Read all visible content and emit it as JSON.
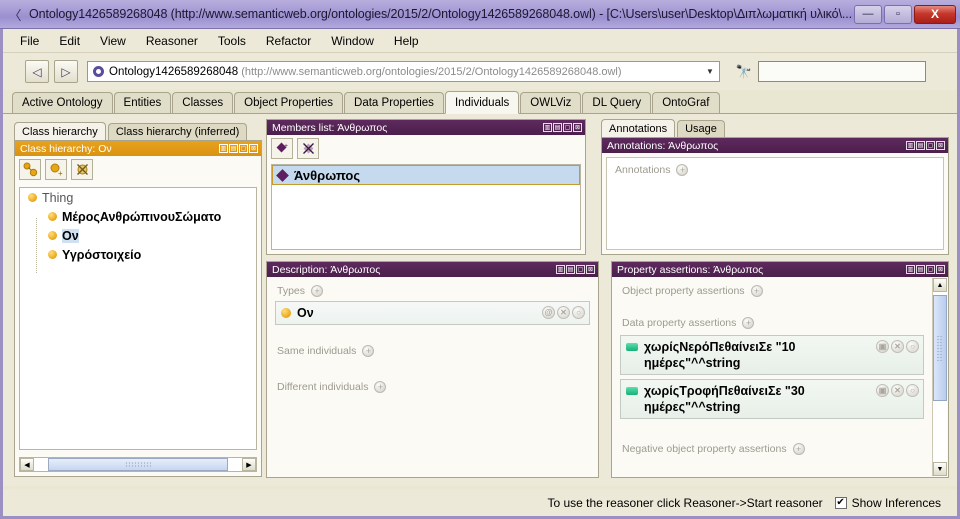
{
  "window": {
    "title": "Ontology1426589268048 (http://www.semanticweb.org/ontologies/2015/2/Ontology1426589268048.owl) - [C:\\Users\\user\\Desktop\\Διπλωματική υλικό\\...",
    "app_icon": "protege-icon",
    "minimize_label": "—",
    "maximize_label": "▫",
    "close_label": "X"
  },
  "menubar": {
    "items": [
      {
        "label": "File"
      },
      {
        "label": "Edit"
      },
      {
        "label": "View"
      },
      {
        "label": "Reasoner"
      },
      {
        "label": "Tools"
      },
      {
        "label": "Refactor"
      },
      {
        "label": "Window"
      },
      {
        "label": "Help"
      }
    ]
  },
  "toolbar": {
    "back_label": "◁",
    "forward_label": "▷",
    "ontology_name": "Ontology1426589268048",
    "ontology_iri": "(http://www.semanticweb.org/ontologies/2015/2/Ontology1426589268048.owl)",
    "dropdown_arrow": "▼",
    "search_icon": "binoculars-icon",
    "search_value": "",
    "search_placeholder": ""
  },
  "tabs": [
    {
      "label": "Active Ontology",
      "active": false
    },
    {
      "label": "Entities",
      "active": false
    },
    {
      "label": "Classes",
      "active": false
    },
    {
      "label": "Object Properties",
      "active": false
    },
    {
      "label": "Data Properties",
      "active": false
    },
    {
      "label": "Individuals",
      "active": true
    },
    {
      "label": "OWLViz",
      "active": false
    },
    {
      "label": "DL Query",
      "active": false
    },
    {
      "label": "OntoGraf",
      "active": false
    }
  ],
  "class_hierarchy": {
    "subtabs": [
      {
        "label": "Class hierarchy",
        "active": true
      },
      {
        "label": "Class hierarchy (inferred)",
        "active": false
      }
    ],
    "panel_title": "Class hierarchy: Ον",
    "tool_buttons": [
      {
        "name": "add-subclass-button"
      },
      {
        "name": "add-sibling-class-button"
      },
      {
        "name": "delete-class-button"
      }
    ],
    "tree": [
      {
        "label": "Thing",
        "level": 0,
        "selected": false
      },
      {
        "label": "ΜέροςΑνθρώπινουΣώματο",
        "level": 1,
        "selected": false
      },
      {
        "label": "Ον",
        "level": 1,
        "selected": true
      },
      {
        "label": "Υγρόστοιχείο",
        "level": 1,
        "selected": false
      }
    ]
  },
  "members_list": {
    "panel_title": "Members list: Άνθρωπος",
    "tool_buttons": [
      {
        "name": "add-individual-button"
      },
      {
        "name": "delete-individual-button"
      }
    ],
    "items": [
      {
        "label": "Άνθρωπος",
        "selected": true
      }
    ]
  },
  "description": {
    "panel_title": "Description: Άνθρωπος",
    "sections": [
      {
        "label": "Types",
        "name": "types-section"
      },
      {
        "label": "Same individuals",
        "name": "same-individuals-section"
      },
      {
        "label": "Different individuals",
        "name": "different-individuals-section"
      }
    ],
    "types_value": "Ον",
    "row_buttons": [
      "@",
      "✕",
      "○"
    ]
  },
  "annotations": {
    "subtabs": [
      {
        "label": "Annotations",
        "active": true
      },
      {
        "label": "Usage",
        "active": false
      }
    ],
    "panel_title": "Annotations: Άνθρωπος",
    "section_label": "Annotations"
  },
  "property_assertions": {
    "panel_title": "Property assertions: Άνθρωπος",
    "sections": [
      {
        "label": "Object property assertions",
        "name": "object-property-assertions-section"
      },
      {
        "label": "Data property assertions",
        "name": "data-property-assertions-section"
      },
      {
        "label": "Negative object property assertions",
        "name": "negative-object-property-assertions-section"
      }
    ],
    "data_assertions": [
      {
        "text": "χωρίςΝερόΠεθαίνειΣε  \"10 ημέρες\"^^string"
      },
      {
        "text": "χωρίςΤροφήΠεθαίνειΣε  \"30 ημέρες\"^^string"
      }
    ],
    "row_buttons": [
      "▣",
      "✕",
      "○"
    ]
  },
  "statusbar": {
    "message": "To use the reasoner click Reasoner->Start reasoner",
    "checkbox_checked": "✔",
    "checkbox_label": "Show Inferences"
  },
  "panel_buttons": [
    "▥",
    "▤",
    "▢",
    "⊠"
  ],
  "colors": {
    "titlebar": "#a89ed6",
    "panel_header_purple": "#4b1f4b",
    "panel_header_gold": "#e09712",
    "selection_blue": "#c6daef",
    "class_bullet": "#e8a617",
    "individual_diamond": "#5d1f5d",
    "data_property": "#16b07a",
    "background": "#ece9d8"
  }
}
